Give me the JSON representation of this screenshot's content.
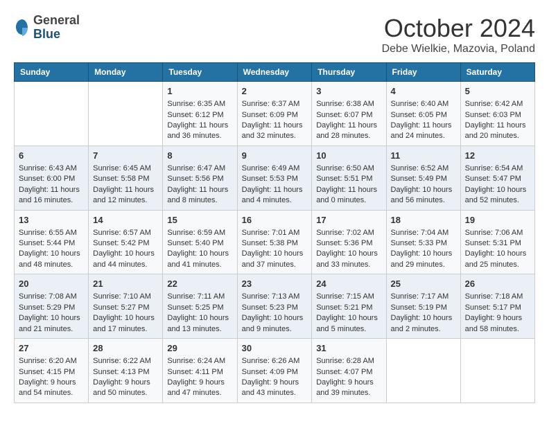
{
  "header": {
    "logo_general": "General",
    "logo_blue": "Blue",
    "month_title": "October 2024",
    "location": "Debe Wielkie, Mazovia, Poland"
  },
  "days_of_week": [
    "Sunday",
    "Monday",
    "Tuesday",
    "Wednesday",
    "Thursday",
    "Friday",
    "Saturday"
  ],
  "weeks": [
    [
      {
        "day": "",
        "info": ""
      },
      {
        "day": "",
        "info": ""
      },
      {
        "day": "1",
        "info": "Sunrise: 6:35 AM\nSunset: 6:12 PM\nDaylight: 11 hours\nand 36 minutes."
      },
      {
        "day": "2",
        "info": "Sunrise: 6:37 AM\nSunset: 6:09 PM\nDaylight: 11 hours\nand 32 minutes."
      },
      {
        "day": "3",
        "info": "Sunrise: 6:38 AM\nSunset: 6:07 PM\nDaylight: 11 hours\nand 28 minutes."
      },
      {
        "day": "4",
        "info": "Sunrise: 6:40 AM\nSunset: 6:05 PM\nDaylight: 11 hours\nand 24 minutes."
      },
      {
        "day": "5",
        "info": "Sunrise: 6:42 AM\nSunset: 6:03 PM\nDaylight: 11 hours\nand 20 minutes."
      }
    ],
    [
      {
        "day": "6",
        "info": "Sunrise: 6:43 AM\nSunset: 6:00 PM\nDaylight: 11 hours\nand 16 minutes."
      },
      {
        "day": "7",
        "info": "Sunrise: 6:45 AM\nSunset: 5:58 PM\nDaylight: 11 hours\nand 12 minutes."
      },
      {
        "day": "8",
        "info": "Sunrise: 6:47 AM\nSunset: 5:56 PM\nDaylight: 11 hours\nand 8 minutes."
      },
      {
        "day": "9",
        "info": "Sunrise: 6:49 AM\nSunset: 5:53 PM\nDaylight: 11 hours\nand 4 minutes."
      },
      {
        "day": "10",
        "info": "Sunrise: 6:50 AM\nSunset: 5:51 PM\nDaylight: 11 hours\nand 0 minutes."
      },
      {
        "day": "11",
        "info": "Sunrise: 6:52 AM\nSunset: 5:49 PM\nDaylight: 10 hours\nand 56 minutes."
      },
      {
        "day": "12",
        "info": "Sunrise: 6:54 AM\nSunset: 5:47 PM\nDaylight: 10 hours\nand 52 minutes."
      }
    ],
    [
      {
        "day": "13",
        "info": "Sunrise: 6:55 AM\nSunset: 5:44 PM\nDaylight: 10 hours\nand 48 minutes."
      },
      {
        "day": "14",
        "info": "Sunrise: 6:57 AM\nSunset: 5:42 PM\nDaylight: 10 hours\nand 44 minutes."
      },
      {
        "day": "15",
        "info": "Sunrise: 6:59 AM\nSunset: 5:40 PM\nDaylight: 10 hours\nand 41 minutes."
      },
      {
        "day": "16",
        "info": "Sunrise: 7:01 AM\nSunset: 5:38 PM\nDaylight: 10 hours\nand 37 minutes."
      },
      {
        "day": "17",
        "info": "Sunrise: 7:02 AM\nSunset: 5:36 PM\nDaylight: 10 hours\nand 33 minutes."
      },
      {
        "day": "18",
        "info": "Sunrise: 7:04 AM\nSunset: 5:33 PM\nDaylight: 10 hours\nand 29 minutes."
      },
      {
        "day": "19",
        "info": "Sunrise: 7:06 AM\nSunset: 5:31 PM\nDaylight: 10 hours\nand 25 minutes."
      }
    ],
    [
      {
        "day": "20",
        "info": "Sunrise: 7:08 AM\nSunset: 5:29 PM\nDaylight: 10 hours\nand 21 minutes."
      },
      {
        "day": "21",
        "info": "Sunrise: 7:10 AM\nSunset: 5:27 PM\nDaylight: 10 hours\nand 17 minutes."
      },
      {
        "day": "22",
        "info": "Sunrise: 7:11 AM\nSunset: 5:25 PM\nDaylight: 10 hours\nand 13 minutes."
      },
      {
        "day": "23",
        "info": "Sunrise: 7:13 AM\nSunset: 5:23 PM\nDaylight: 10 hours\nand 9 minutes."
      },
      {
        "day": "24",
        "info": "Sunrise: 7:15 AM\nSunset: 5:21 PM\nDaylight: 10 hours\nand 5 minutes."
      },
      {
        "day": "25",
        "info": "Sunrise: 7:17 AM\nSunset: 5:19 PM\nDaylight: 10 hours\nand 2 minutes."
      },
      {
        "day": "26",
        "info": "Sunrise: 7:18 AM\nSunset: 5:17 PM\nDaylight: 9 hours\nand 58 minutes."
      }
    ],
    [
      {
        "day": "27",
        "info": "Sunrise: 6:20 AM\nSunset: 4:15 PM\nDaylight: 9 hours\nand 54 minutes."
      },
      {
        "day": "28",
        "info": "Sunrise: 6:22 AM\nSunset: 4:13 PM\nDaylight: 9 hours\nand 50 minutes."
      },
      {
        "day": "29",
        "info": "Sunrise: 6:24 AM\nSunset: 4:11 PM\nDaylight: 9 hours\nand 47 minutes."
      },
      {
        "day": "30",
        "info": "Sunrise: 6:26 AM\nSunset: 4:09 PM\nDaylight: 9 hours\nand 43 minutes."
      },
      {
        "day": "31",
        "info": "Sunrise: 6:28 AM\nSunset: 4:07 PM\nDaylight: 9 hours\nand 39 minutes."
      },
      {
        "day": "",
        "info": ""
      },
      {
        "day": "",
        "info": ""
      }
    ]
  ]
}
